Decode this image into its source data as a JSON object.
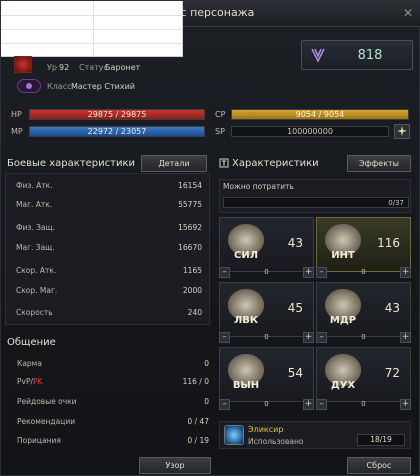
{
  "window": {
    "title": "тус персонажа",
    "close_glyph": "✕"
  },
  "header": {
    "level_label": "Ур",
    "level": "92",
    "status_label": "Статус",
    "status": "Баронет",
    "class_label": "Класс",
    "class": "Мастер Стихий",
    "power": "818"
  },
  "bars": {
    "hp_label": "HP",
    "hp": "29875 / 29875",
    "hp_fill": 1.0,
    "mp_label": "MP",
    "mp": "22972 / 23057",
    "mp_fill": 0.996,
    "cp_label": "CP",
    "cp": "9054 / 9054",
    "cp_fill": 1.0,
    "sp_label": "SP",
    "sp": "100000000"
  },
  "combat": {
    "title": "Боевые характеристики",
    "details_label": "Детали",
    "rows": [
      {
        "name": "Физ. Атк.",
        "value": "16154"
      },
      {
        "name": "Маг. Атк.",
        "value": "55775"
      },
      {
        "name": "Физ. Защ.",
        "value": "15692"
      },
      {
        "name": "Маг. Защ.",
        "value": "16670"
      },
      {
        "name": "Скор. Атк.",
        "value": "1165"
      },
      {
        "name": "Скор. Маг.",
        "value": "2000"
      },
      {
        "name": "Скорость",
        "value": "240"
      }
    ]
  },
  "social": {
    "title": "Общение",
    "rows": [
      {
        "name": "Карма",
        "value": "0"
      },
      {
        "name": "PvP/",
        "name_pk": "PK",
        "value": "116 / 0"
      },
      {
        "name": "Рейдовые очки",
        "value": "0"
      },
      {
        "name": "Рекомендации",
        "value": "0 / 47"
      },
      {
        "name": "Порицания",
        "value": "0 / 19"
      }
    ]
  },
  "characteristics": {
    "title": "Характеристики",
    "effects_label": "Эффекты",
    "spend_label": "Можно потратить",
    "spend_value": "0/37",
    "stats": [
      {
        "abbr": "СИЛ",
        "value": "43",
        "points": "0"
      },
      {
        "abbr": "ИНТ",
        "value": "116",
        "points": "0"
      },
      {
        "abbr": "ЛВК",
        "value": "45",
        "points": "0"
      },
      {
        "abbr": "МДР",
        "value": "43",
        "points": "0"
      },
      {
        "abbr": "ВЫН",
        "value": "54",
        "points": "0"
      },
      {
        "abbr": "ДУХ",
        "value": "72",
        "points": "0"
      }
    ],
    "elixir_name": "Эликсир",
    "elixir_used_label": "Использовано",
    "elixir_count": "18/19"
  },
  "footer": {
    "pattern_label": "Узор",
    "reset_label": "Сброс"
  },
  "colors": {
    "hp": "#c63730",
    "mp": "#3b79c4",
    "cp": "#d6a52e",
    "pk": "#e04040",
    "accent": "#e8c23a"
  }
}
